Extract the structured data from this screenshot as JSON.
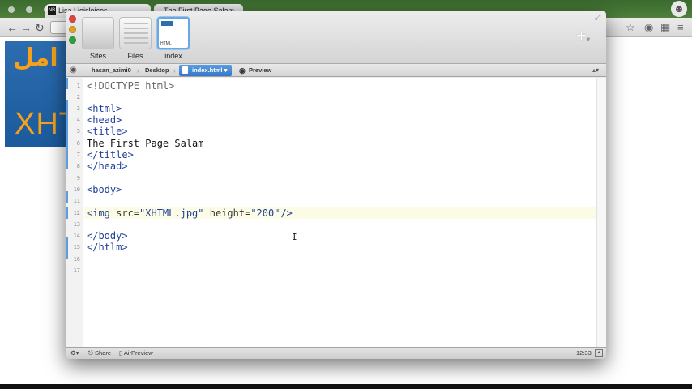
{
  "browser": {
    "tab_title": "Lisa Lieisleicos...",
    "tab2_title": "The First Page Salam",
    "favicon": "NB"
  },
  "coda": {
    "modes": [
      {
        "label": "Sites"
      },
      {
        "label": "Files"
      },
      {
        "label": "index",
        "thumb_text": "HTML"
      }
    ],
    "plus_label": "+",
    "path": [
      {
        "label": "hasan_azimi0"
      },
      {
        "label": "Desktop"
      },
      {
        "label": "index.html"
      },
      {
        "label": "Preview"
      }
    ],
    "editor": {
      "line_numbers": [
        "1",
        "2",
        "3",
        "4",
        "5",
        "6",
        "7",
        "8",
        "9",
        "10",
        "11",
        "12",
        "13",
        "14",
        "15",
        "16",
        "17"
      ],
      "lines": {
        "l1": "<!DOCTYPE html>",
        "l3": "<html>",
        "l4": "<head>",
        "l5": "<title>",
        "l6": "The First Page Salam",
        "l7": "</title>",
        "l8": "</head>",
        "l10": "<body>",
        "l12_a": "<img ",
        "l12_b": "src=",
        "l12_c": "\"XHTML.jpg\"",
        "l12_d": " height=",
        "l12_e": "\"200\"",
        "l12_f": "/>",
        "l14": "</body>",
        "l15": "</htlm>"
      },
      "current_line": "12"
    },
    "status": {
      "share": "Share",
      "airpreview": "AirPreview",
      "clock": "12:33"
    }
  },
  "page_image": {
    "arabic": "امل",
    "latin": "XHT"
  },
  "colors": {
    "accent": "#3577c7",
    "tag": "#1f3f9a"
  }
}
